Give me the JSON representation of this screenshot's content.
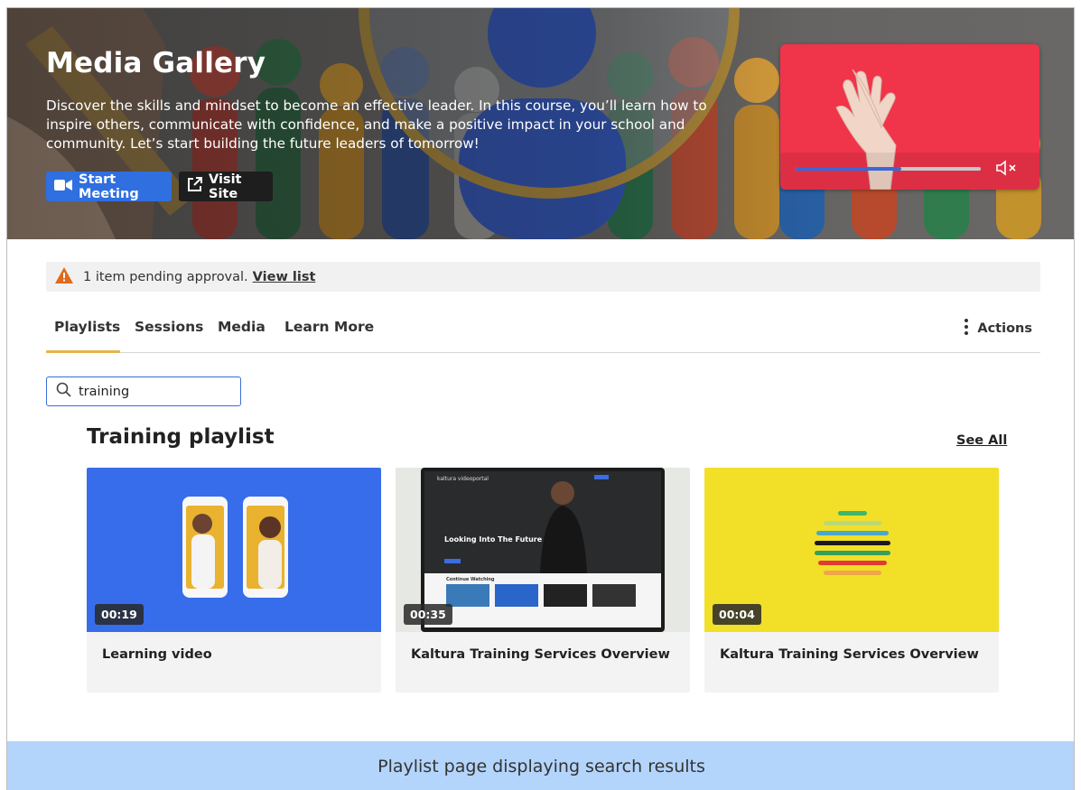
{
  "hero": {
    "title": "Media Gallery",
    "description": "Discover the skills and mindset to become an effective leader. In this course, you’ll learn how to inspire others, communicate with confidence, and make a positive impact in your school and community. Let’s start building the future leaders of tomorrow!",
    "start_meeting_label": "Start Meeting",
    "visit_site_label": "Visit Site",
    "video_progress_percent": 57
  },
  "alert": {
    "message": "1 item pending approval.",
    "link_label": "View list"
  },
  "tabs": [
    {
      "label": "Playlists",
      "active": true
    },
    {
      "label": "Sessions",
      "active": false
    },
    {
      "label": "Media",
      "active": false
    },
    {
      "label": "Learn More",
      "active": false
    }
  ],
  "actions_label": "Actions",
  "search": {
    "value": "training",
    "placeholder": ""
  },
  "playlist": {
    "title": "Training playlist",
    "see_all_label": "See All",
    "items": [
      {
        "title": "Learning video",
        "duration": "00:19"
      },
      {
        "title": "Kaltura Training Services Overview",
        "duration": "00:35",
        "thumb_text": "Looking Into The Future",
        "thumb_brand": "kaltura videoportal",
        "thumb_row_label": "Continue Watching"
      },
      {
        "title": "Kaltura Training Services Overview",
        "duration": "00:04"
      }
    ]
  },
  "caption": "Playlist page displaying search results",
  "colors": {
    "primary_button": "#2f6fe0",
    "tab_active_underline": "#e8b54a",
    "alert_icon": "#e06a1c",
    "caption_bg": "#b3d4fb"
  }
}
